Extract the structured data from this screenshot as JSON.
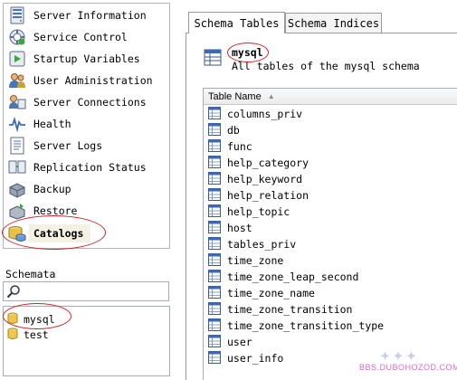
{
  "nav": {
    "items": [
      {
        "label": "Server Information",
        "icon": "server-info-icon"
      },
      {
        "label": "Service Control",
        "icon": "service-control-icon"
      },
      {
        "label": "Startup Variables",
        "icon": "startup-variables-icon"
      },
      {
        "label": "User Administration",
        "icon": "users-icon"
      },
      {
        "label": "Server Connections",
        "icon": "connections-icon"
      },
      {
        "label": "Health",
        "icon": "health-icon"
      },
      {
        "label": "Server Logs",
        "icon": "logs-icon"
      },
      {
        "label": "Replication Status",
        "icon": "replication-icon"
      },
      {
        "label": "Backup",
        "icon": "backup-icon"
      },
      {
        "label": "Restore",
        "icon": "restore-icon"
      },
      {
        "label": "Catalogs",
        "icon": "catalogs-icon",
        "selected": true
      }
    ]
  },
  "schemata": {
    "title": "Schemata",
    "search_value": "",
    "items": [
      {
        "label": "mysql",
        "selected": true
      },
      {
        "label": "test"
      }
    ]
  },
  "tabs": [
    {
      "label": "Schema Tables",
      "active": true
    },
    {
      "label": "Schema Indices"
    }
  ],
  "schema_header": {
    "name": "mysql",
    "description": "All tables of the mysql schema"
  },
  "table_list": {
    "column_header": "Table Name",
    "rows": [
      "columns_priv",
      "db",
      "func",
      "help_category",
      "help_keyword",
      "help_relation",
      "help_topic",
      "host",
      "tables_priv",
      "time_zone",
      "time_zone_leap_second",
      "time_zone_name",
      "time_zone_transition",
      "time_zone_transition_type",
      "user",
      "user_info"
    ]
  },
  "watermark": "BBS.DUBOHOZOD.COM",
  "colors": {
    "annotation": "#d42020",
    "selected_bg": "#f3f1e3",
    "border": "#a5acb5"
  }
}
